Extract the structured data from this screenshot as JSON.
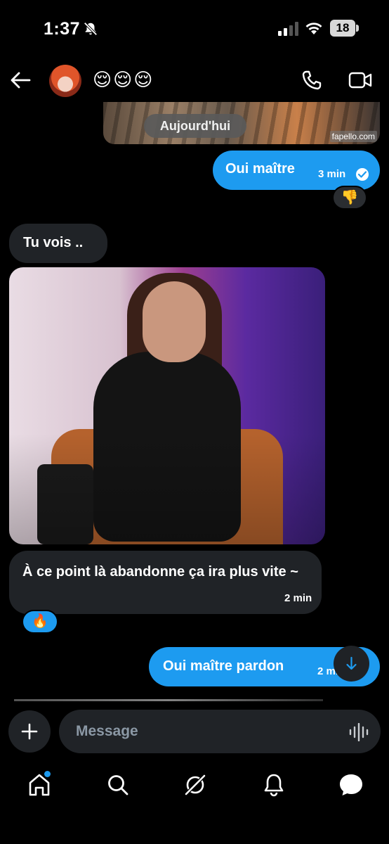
{
  "status_bar": {
    "time": "1:37",
    "battery": "18"
  },
  "header": {
    "contact_name": "😌😌😌"
  },
  "conversation": {
    "date_separator": "Aujourd'hui",
    "image_watermark": "fapello.com",
    "messages": [
      {
        "direction": "out",
        "text": "Oui maître",
        "time": "3 min",
        "reaction": "👎"
      },
      {
        "direction": "in",
        "text": "Tu vois .."
      },
      {
        "direction": "in",
        "type": "image"
      },
      {
        "direction": "in",
        "text": "À ce point là abandonne ça ira plus vite ~",
        "time": "2 min",
        "reaction": "🔥"
      },
      {
        "direction": "out",
        "text": "Oui maître pardon",
        "time": "2 min"
      }
    ]
  },
  "composer": {
    "placeholder": "Message"
  },
  "tab_bar": {
    "items": [
      "home-icon",
      "search-icon",
      "grok-icon",
      "notifications-icon",
      "messages-icon"
    ]
  },
  "colors": {
    "accent": "#1d9bf0",
    "bubble_in": "#202327",
    "background": "#000000"
  }
}
